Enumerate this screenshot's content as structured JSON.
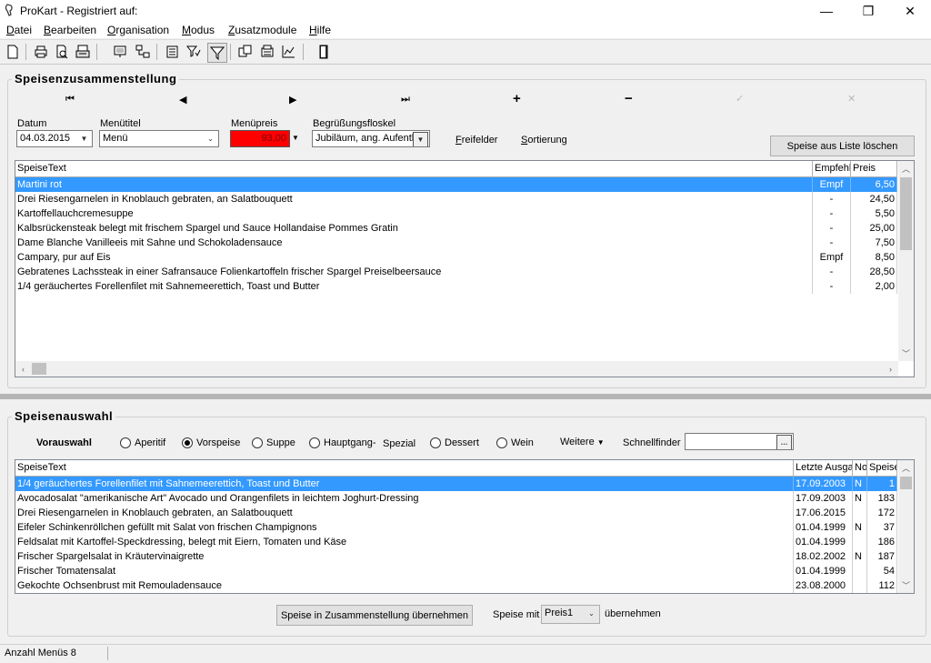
{
  "window": {
    "title": "ProKart - Registriert auf:",
    "controls": {
      "minimize": "—",
      "maximize": "❐",
      "close": "✕"
    }
  },
  "menu": [
    "Datei",
    "Bearbeiten",
    "Organisation",
    "Modus",
    "Zusatzmodule",
    "Hilfe"
  ],
  "toolbar_icons": [
    "new-document-icon",
    "print-icon",
    "print-preview-icon",
    "print-setup-icon",
    "monitor-icon",
    "network-icon",
    "list-icon",
    "filter-list-icon",
    "filter-icon",
    "copy-icon",
    "export-icon",
    "chart-icon",
    "exit-door-icon"
  ],
  "composition": {
    "title": "Speisenzusammenstellung",
    "nav": {
      "first": "⏮",
      "prev": "◀",
      "next": "▶",
      "last": "⏭",
      "add": "+",
      "remove": "−",
      "confirm": "✓",
      "cancel": "✕"
    },
    "fields": {
      "date_label": "Datum",
      "date_value": "04.03.2015",
      "menu_title_label": "Menütitel",
      "menu_title_value": "Menü",
      "menu_price_label": "Menüpreis",
      "menu_price_value": "93,00",
      "greeting_label": "Begrüßungsfloskel",
      "greeting_value": "Jubiläum, ang. Aufenth"
    },
    "links": {
      "free_fields": "Freifelder",
      "sorting": "Sortierung"
    },
    "delete_button": "Speise aus Liste löschen",
    "grid": {
      "headers": [
        "SpeiseText",
        "Empfehl",
        "Preis"
      ],
      "rows": [
        [
          "Martini rot",
          "Empf",
          "6,50"
        ],
        [
          "Drei Riesengarnelen in Knoblauch gebraten, an Salatbouquett",
          "-",
          "24,50"
        ],
        [
          "Kartoffellauchcremesuppe",
          "-",
          "5,50"
        ],
        [
          "Kalbsrückensteak belegt mit frischem Spargel und Sauce Hollandaise Pommes Gratin",
          "-",
          "25,00"
        ],
        [
          "Dame Blanche Vanilleeis mit Sahne und Schokoladensauce",
          "-",
          "7,50"
        ],
        [
          "Campary, pur auf Eis",
          "Empf",
          "8,50"
        ],
        [
          "Gebratenes Lachssteak in einer Safransauce Folienkartoffeln frischer Spargel Preiselbeersauce",
          "-",
          "28,50"
        ],
        [
          "1/4 geräuchertes Forellenfilet mit Sahnemeerettich, Toast und Butter",
          "-",
          "2,00"
        ]
      ],
      "selected_row": 0
    }
  },
  "selection": {
    "title": "Speisenauswahl",
    "preselect_label": "Vorauswahl",
    "radios": [
      {
        "label": "Aperitif",
        "checked": false
      },
      {
        "label": "Vorspeise",
        "checked": true
      },
      {
        "label": "Suppe",
        "checked": false
      },
      {
        "label": "Hauptgang-",
        "checked": false
      },
      {
        "label": "Dessert",
        "checked": false
      },
      {
        "label": "Wein",
        "checked": false
      }
    ],
    "special_label": "Spezial",
    "more_label": "Weitere",
    "quickfind_label": "Schnellfinder",
    "quickfind_value": "",
    "grid": {
      "headers": [
        "SpeiseText",
        "Letzte Ausga",
        "No",
        "Speise"
      ],
      "rows": [
        [
          "1/4 geräuchertes Forellenfilet mit Sahnemeerettich, Toast und Butter",
          "17.09.2003",
          "N",
          "1"
        ],
        [
          "Avocadosalat \"amerikanische Art\" Avocado und Orangenfilets in leichtem Joghurt-Dressing",
          "17.09.2003",
          "N",
          "183"
        ],
        [
          "Drei Riesengarnelen in Knoblauch gebraten, an Salatbouquett",
          "17.06.2015",
          "",
          "172"
        ],
        [
          "Eifeler Schinkenröllchen gefüllt mit Salat von frischen Champignons",
          "01.04.1999",
          "N",
          "37"
        ],
        [
          "Feldsalat mit Kartoffel-Speckdressing, belegt mit Eiern, Tomaten und Käse",
          "01.04.1999",
          "",
          "186"
        ],
        [
          "Frischer Spargelsalat in Kräutervinaigrette",
          "18.02.2002",
          "N",
          "187"
        ],
        [
          "Frischer Tomatensalat",
          "01.04.1999",
          "",
          "54"
        ],
        [
          "Gekochte Ochsenbrust mit Remouladensauce",
          "23.08.2000",
          "",
          "112"
        ]
      ],
      "selected_row": 0
    },
    "take_over_button": "Speise in Zusammenstellung übernehmen",
    "dish_with_label": "Speise mit",
    "price_select_value": "Preis1",
    "take_over_suffix": "übernehmen"
  },
  "status": {
    "menu_count": "Anzahl Menüs 8"
  }
}
